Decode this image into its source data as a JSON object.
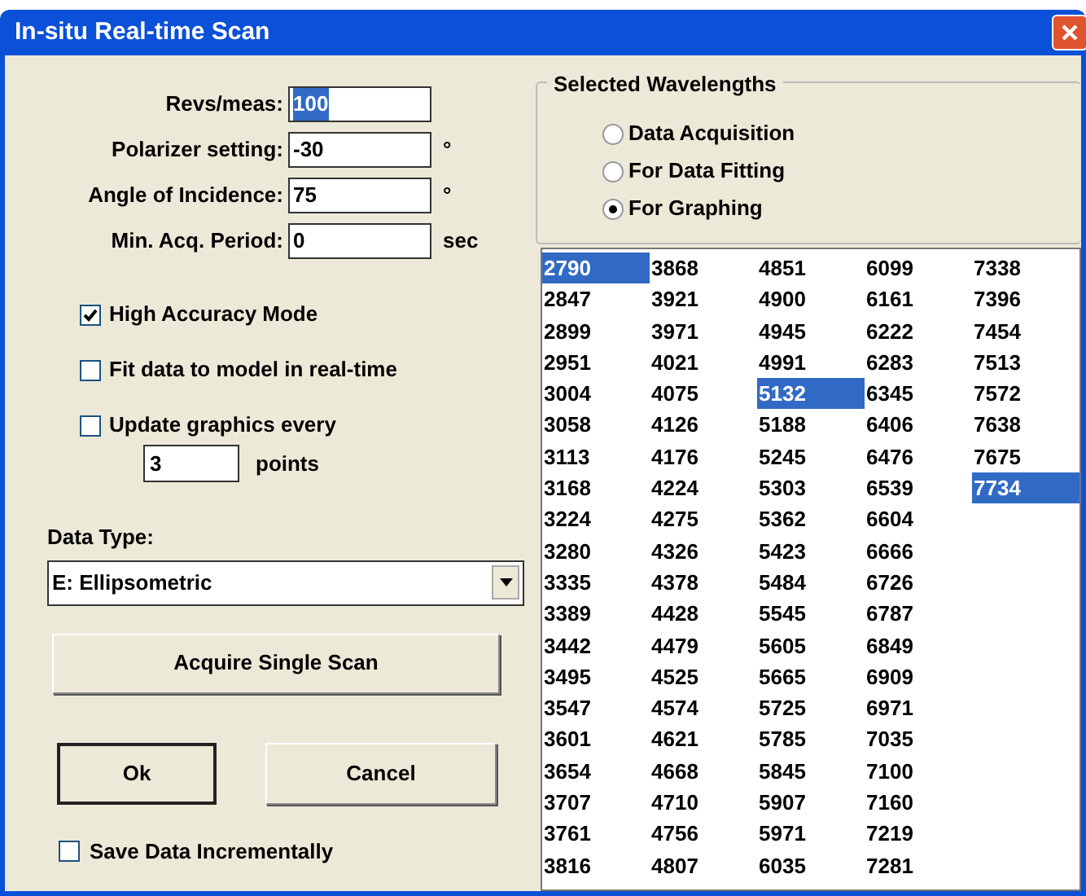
{
  "window": {
    "title": "In-situ Real-time Scan"
  },
  "fields": [
    {
      "label": "Revs/meas:",
      "value": "100",
      "selected": true
    },
    {
      "label": "Polarizer setting:",
      "value": "-30",
      "selected": false,
      "unit": "°"
    },
    {
      "label": "Angle of Incidence:",
      "value": "75",
      "selected": false,
      "unit": "°"
    },
    {
      "label": "Min. Acq. Period:",
      "value": "0",
      "selected": false,
      "unit": "sec"
    }
  ],
  "options": [
    {
      "label": "High Accuracy Mode",
      "checked": true
    },
    {
      "label": "Fit data to model in real-time",
      "checked": false
    },
    {
      "label": "Update graphics every",
      "checked": false
    }
  ],
  "update_interval": {
    "value": "3",
    "unit": "points"
  },
  "data_type": {
    "label": "Data Type:",
    "value": "E: Ellipsometric"
  },
  "acquire_button": "Acquire Single Scan",
  "buttons": [
    {
      "label": "Ok",
      "default": true
    },
    {
      "label": "Cancel",
      "default": false
    }
  ],
  "save_incrementally": {
    "label": "Save Data Incrementally",
    "checked": false
  },
  "wavelength_group": {
    "title": "Selected Wavelengths",
    "modes": [
      {
        "label": "Data Acquisition",
        "selected": false
      },
      {
        "label": "For Data Fitting",
        "selected": false
      },
      {
        "label": "For Graphing",
        "selected": true
      }
    ]
  },
  "wavelengths": [
    {
      "value": "2790",
      "selected": true
    },
    {
      "value": "2847",
      "selected": false
    },
    {
      "value": "2899",
      "selected": false
    },
    {
      "value": "2951",
      "selected": false
    },
    {
      "value": "3004",
      "selected": false
    },
    {
      "value": "3058",
      "selected": false
    },
    {
      "value": "3113",
      "selected": false
    },
    {
      "value": "3168",
      "selected": false
    },
    {
      "value": "3224",
      "selected": false
    },
    {
      "value": "3280",
      "selected": false
    },
    {
      "value": "3335",
      "selected": false
    },
    {
      "value": "3389",
      "selected": false
    },
    {
      "value": "3442",
      "selected": false
    },
    {
      "value": "3495",
      "selected": false
    },
    {
      "value": "3547",
      "selected": false
    },
    {
      "value": "3601",
      "selected": false
    },
    {
      "value": "3654",
      "selected": false
    },
    {
      "value": "3707",
      "selected": false
    },
    {
      "value": "3761",
      "selected": false
    },
    {
      "value": "3816",
      "selected": false
    },
    {
      "value": "3868",
      "selected": false
    },
    {
      "value": "3921",
      "selected": false
    },
    {
      "value": "3971",
      "selected": false
    },
    {
      "value": "4021",
      "selected": false
    },
    {
      "value": "4075",
      "selected": false
    },
    {
      "value": "4126",
      "selected": false
    },
    {
      "value": "4176",
      "selected": false
    },
    {
      "value": "4224",
      "selected": false
    },
    {
      "value": "4275",
      "selected": false
    },
    {
      "value": "4326",
      "selected": false
    },
    {
      "value": "4378",
      "selected": false
    },
    {
      "value": "4428",
      "selected": false
    },
    {
      "value": "4479",
      "selected": false
    },
    {
      "value": "4525",
      "selected": false
    },
    {
      "value": "4574",
      "selected": false
    },
    {
      "value": "4621",
      "selected": false
    },
    {
      "value": "4668",
      "selected": false
    },
    {
      "value": "4710",
      "selected": false
    },
    {
      "value": "4756",
      "selected": false
    },
    {
      "value": "4807",
      "selected": false
    },
    {
      "value": "4851",
      "selected": false
    },
    {
      "value": "4900",
      "selected": false
    },
    {
      "value": "4945",
      "selected": false
    },
    {
      "value": "4991",
      "selected": false
    },
    {
      "value": "5132",
      "selected": true
    },
    {
      "value": "5188",
      "selected": false
    },
    {
      "value": "5245",
      "selected": false
    },
    {
      "value": "5303",
      "selected": false
    },
    {
      "value": "5362",
      "selected": false
    },
    {
      "value": "5423",
      "selected": false
    },
    {
      "value": "5484",
      "selected": false
    },
    {
      "value": "5545",
      "selected": false
    },
    {
      "value": "5605",
      "selected": false
    },
    {
      "value": "5665",
      "selected": false
    },
    {
      "value": "5725",
      "selected": false
    },
    {
      "value": "5785",
      "selected": false
    },
    {
      "value": "5845",
      "selected": false
    },
    {
      "value": "5907",
      "selected": false
    },
    {
      "value": "5971",
      "selected": false
    },
    {
      "value": "6035",
      "selected": false
    },
    {
      "value": "6099",
      "selected": false
    },
    {
      "value": "6161",
      "selected": false
    },
    {
      "value": "6222",
      "selected": false
    },
    {
      "value": "6283",
      "selected": false
    },
    {
      "value": "6345",
      "selected": false
    },
    {
      "value": "6406",
      "selected": false
    },
    {
      "value": "6476",
      "selected": false
    },
    {
      "value": "6539",
      "selected": false
    },
    {
      "value": "6604",
      "selected": false
    },
    {
      "value": "6666",
      "selected": false
    },
    {
      "value": "6726",
      "selected": false
    },
    {
      "value": "6787",
      "selected": false
    },
    {
      "value": "6849",
      "selected": false
    },
    {
      "value": "6909",
      "selected": false
    },
    {
      "value": "6971",
      "selected": false
    },
    {
      "value": "7035",
      "selected": false
    },
    {
      "value": "7100",
      "selected": false
    },
    {
      "value": "7160",
      "selected": false
    },
    {
      "value": "7219",
      "selected": false
    },
    {
      "value": "7281",
      "selected": false
    },
    {
      "value": "7338",
      "selected": false
    },
    {
      "value": "7396",
      "selected": false
    },
    {
      "value": "7454",
      "selected": false
    },
    {
      "value": "7513",
      "selected": false
    },
    {
      "value": "7572",
      "selected": false
    },
    {
      "value": "7638",
      "selected": false
    },
    {
      "value": "7675",
      "selected": false
    },
    {
      "value": "7734",
      "selected": true
    }
  ]
}
